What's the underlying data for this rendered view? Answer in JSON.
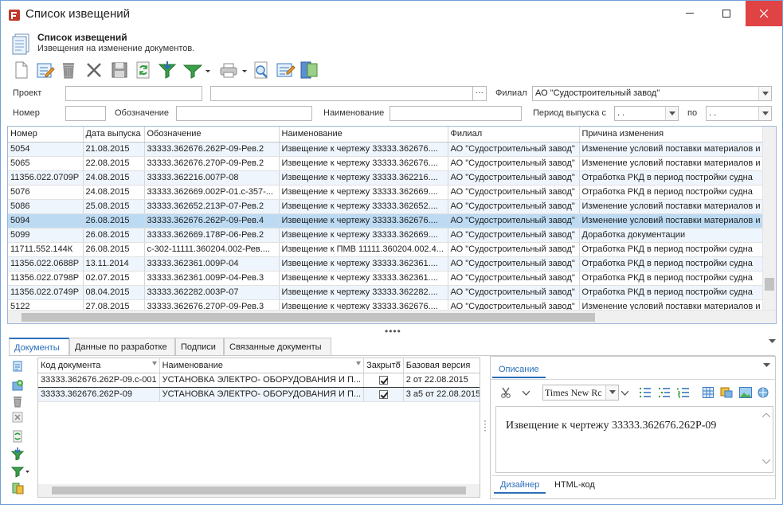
{
  "window": {
    "title": "Список извещений"
  },
  "header": {
    "title": "Список извещений",
    "subtitle": "Извещения на изменение документов."
  },
  "toolbar": {
    "buttons": [
      "new-icon",
      "edit-icon",
      "delete-icon",
      "cancel-icon",
      "save-icon",
      "refresh-icon",
      "filter-down-icon",
      "filter-icon",
      "printer-icon",
      "preview-icon",
      "edit-document-icon",
      "export-icon"
    ]
  },
  "filters": {
    "project_label": "Проект",
    "project_value": "",
    "project_extra": "",
    "browse_label": "···",
    "branch_label": "Филиал",
    "branch_value": "АО \"Судостроительный завод\"",
    "number_label": "Номер",
    "number_value": "",
    "designation_label": "Обозначение",
    "designation_value": "",
    "name_label": "Наименование",
    "name_value": "",
    "period_label": "Период выпуска с",
    "period_from": " .  .",
    "period_to_label": "по",
    "period_to": " .  ."
  },
  "grid": {
    "columns": [
      "Номер",
      "Дата выпуска",
      "Обозначение",
      "Наименование",
      "Филиал",
      "Причина изменения"
    ],
    "rows": [
      [
        "5054",
        "21.08.2015",
        "33333.362676.262Р-09-Рев.2",
        "Извещение к чертежу 33333.362676....",
        "АО \"Судостроительный завод\"",
        "Изменение условий поставки материалов и ..."
      ],
      [
        "5065",
        "22.08.2015",
        "33333.362676.270Р-09-Рев.2",
        "Извещение к чертежу 33333.362676....",
        "АО \"Судостроительный завод\"",
        "Изменение условий поставки материалов и ..."
      ],
      [
        "11356.022.0709Р",
        "24.08.2015",
        "33333.362216.007Р-08",
        "Извещение к чертежу 33333.362216....",
        "АО \"Судостроительный завод\"",
        "Отработка РКД в период постройки судна"
      ],
      [
        "5076",
        "24.08.2015",
        "33333.362669.002Р-01.с-357-...",
        "Извещение к чертежу 33333.362669....",
        "АО \"Судостроительный завод\"",
        "Отработка РКД в период постройки судна"
      ],
      [
        "5086",
        "25.08.2015",
        "33333.362652.213Р-07-Рев.2",
        "Извещение к чертежу 33333.362652....",
        "АО \"Судостроительный завод\"",
        "Изменение условий поставки материалов и ..."
      ],
      [
        "5094",
        "26.08.2015",
        "33333.362676.262Р-09-Рев.4",
        "Извещение к чертежу 33333.362676....",
        "АО \"Судостроительный завод\"",
        "Изменение условий поставки материалов и ..."
      ],
      [
        "5099",
        "26.08.2015",
        "33333.362669.178Р-06-Рев.2",
        "Извещение к чертежу 33333.362669....",
        "АО \"Судостроительный завод\"",
        "Доработка документации"
      ],
      [
        "11711.552.144К",
        "26.08.2015",
        "с-302-11111.360204.002-Рев....",
        "Извещение к ПМВ 11111.360204.002.4...",
        "АО \"Судостроительный завод\"",
        "Отработка РКД в период постройки судна"
      ],
      [
        "11356.022.0688Р",
        "13.11.2014",
        "33333.362361.009Р-04",
        "Извещение к чертежу 33333.362361....",
        "АО \"Судостроительный завод\"",
        "Отработка РКД в период постройки судна"
      ],
      [
        "11356.022.0798Р",
        "02.07.2015",
        "33333.362361.009Р-04-Рев.3",
        "Извещение к чертежу 33333.362361....",
        "АО \"Судостроительный завод\"",
        "Отработка РКД в период постройки судна"
      ],
      [
        "11356.022.0749Р",
        "08.04.2015",
        "33333.362282.003Р-07",
        "Извещение к чертежу 33333.362282....",
        "АО \"Судостроительный завод\"",
        "Отработка РКД в период постройки судна"
      ],
      [
        "5122",
        "27.08.2015",
        "33333.362676.270Р-09-Рев.3",
        "Извещение к чертежу 33333.362676....",
        "АО \"Судостроительный завод\"",
        "Изменение условий поставки материалов и ..."
      ]
    ],
    "selected_index": 5
  },
  "splitter": "••••",
  "tabs": [
    "Документы",
    "Данные по разработке",
    "Подписи",
    "Связанные документы"
  ],
  "docs": {
    "columns": [
      "Код документа",
      "Наименование",
      "Закрыто",
      "Базовая версия"
    ],
    "rows": [
      [
        "33333.362676.262Р-09.с-001",
        "УСТАНОВКА ЭЛЕКТРО- ОБОРУДОВАНИЯ И П...",
        true,
        "2  от 22.08.2015"
      ],
      [
        "33333.362676.262Р-09",
        "УСТАНОВКА ЭЛЕКТРО- ОБОРУДОВАНИЯ И П...",
        true,
        "3 а5 от 22.08.2015"
      ]
    ]
  },
  "description": {
    "tab": "Описание",
    "font": "Times New Rc",
    "text": "Извещение к чертежу 33333.362676.262Р-09",
    "bottom_tabs": [
      "Дизайнер",
      "HTML-код"
    ]
  }
}
